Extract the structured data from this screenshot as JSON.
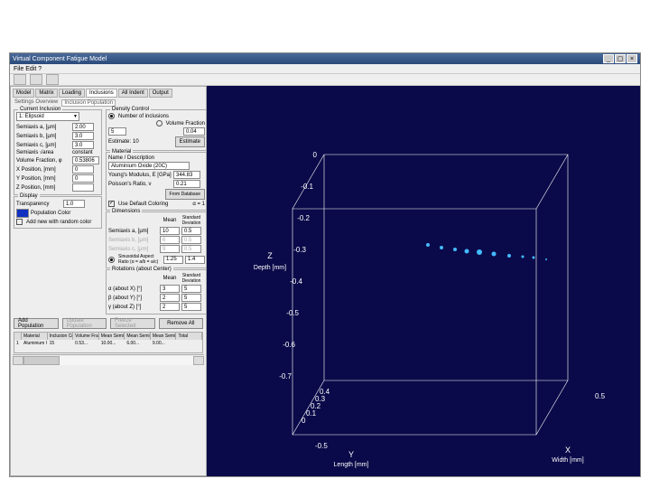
{
  "slide": {
    "title": "Virtual Component Fatigue Model"
  },
  "window": {
    "title": "Virtual Component Fatigue Model",
    "menu": "File  Edit  ?"
  },
  "tabs": [
    "Model",
    "Matrix",
    "Loading",
    "Inclusions",
    "All Indent",
    "Output"
  ],
  "subtabs": "Settings  Overview",
  "activeSubtab": "Inclusion Population",
  "currentInclusion": {
    "group": "Current Inclusion",
    "sel": "1: Elipsoid",
    "semiaLbl": "Semiaxis a, [µm]",
    "semia": "2.00",
    "semibLbl": "Semiaxis b, [µm]",
    "semib": "3.0",
    "semicLbl": "Semiaxis c, [µm]",
    "semic": "3.0",
    "areaLbl": "Semiaxis √area",
    "area": "constant",
    "vfLbl": "Volume Fraction, φ",
    "vf": "0.53806",
    "xposLbl": "X Position, [mm]",
    "xpos": "0",
    "yposLbl": "Y Position, [mm]",
    "ypos": "0",
    "zposLbl": "Z Position, [mm]",
    "zpos": ""
  },
  "density": {
    "group": "Density Control",
    "r1": "Number of inclusions",
    "r2": "Volume Fraction",
    "n": "5",
    "vf": "0.04",
    "estLbl": "Estimate:",
    "estVal": "10",
    "estBtn": "Estimate"
  },
  "material": {
    "group": "Material",
    "nameLbl": "Name / Description",
    "name": "Aluminium Oxide (20C)",
    "ymLbl": "Young's Modulus, E [GPa]",
    "ym": "344.83",
    "prLbl": "Poisson's Ratio, ν",
    "pr": "0.21",
    "dbBtn": "From Database",
    "defLbl": "Use Default Coloring",
    "alpha": "α = 1"
  },
  "display": {
    "group": "Display",
    "transLbl": "Transparency",
    "trans": "1.0",
    "popLbl": "Population Color",
    "chkLbl": "Add new with random color"
  },
  "dimensions": {
    "group": "Dimensions",
    "mean": "Mean",
    "sd": "Standard Deviation",
    "aLbl": "Semiaxis a, [µm]",
    "aM": "10",
    "aS": "0.5",
    "bLbl": "Semiaxis b, [µm]",
    "bM": "6",
    "bS": "0.5",
    "cLbl": "Semiaxis c, [µm]",
    "cM": "9",
    "cS": "0.5",
    "arLbl": "Sinusoidal Aspect Ratio (α = a/b = a/c)",
    "arM": "1.25",
    "arS": "1.4"
  },
  "rotations": {
    "group": "Rotations (about Center)",
    "mean": "Mean",
    "sd": "Standard Deviation",
    "xLbl": "α (about X) [°]",
    "xM": "3",
    "xS": "5",
    "yLbl": "β (about Y) [°]",
    "yM": "2",
    "yS": "5",
    "zLbl": "γ (about Z) [°]",
    "zM": "2",
    "zS": "5"
  },
  "actions": {
    "add": "Add Population",
    "upd": "Update Population",
    "freeze": "Freeze Selected",
    "remove": "Remove All"
  },
  "table": {
    "headers": [
      "",
      "Material",
      "Inclusion Count",
      "Volume Fraction",
      "Mean Semi-Axis a [µm]",
      "Mean Semi-Axis b [µm]",
      "Mean Semi-Axis c [µm]",
      "Total"
    ],
    "row": [
      "1",
      "Aluminium Ox",
      "15",
      "0.53...",
      "10.00...",
      "6.00...",
      "9.00...",
      ""
    ]
  },
  "viz": {
    "zLabel": "Z\nDepth [mm]",
    "xLabel": "X\nWidth [mm]",
    "yLabel": "Y\nLength [mm]",
    "zTicks": [
      "0",
      "-0.1",
      "-0.2",
      "-0.3",
      "-0.4",
      "-0.5",
      "-0.6",
      "-0.7"
    ],
    "xTicks": [
      "-0.5",
      "0",
      "0.5"
    ],
    "yTicks": [
      "0.4",
      "0.3",
      "0.2",
      "0.1",
      "0",
      "-0.5",
      "-0.5"
    ]
  }
}
